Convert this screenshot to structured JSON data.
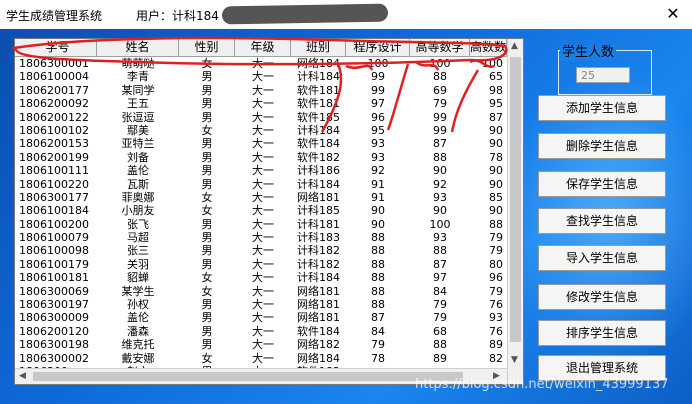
{
  "window": {
    "title": "学生成绩管理系统",
    "user_label": "用户：计科184",
    "close": "✕"
  },
  "table": {
    "columns": [
      "学号",
      "姓名",
      "性别",
      "年级",
      "班别",
      "程序设计",
      "高等数学",
      "高数数"
    ],
    "rows": [
      [
        "1806300001",
        "萌萌哒",
        "女",
        "大一",
        "网络184",
        "100",
        "100",
        "100"
      ],
      [
        "1806100004",
        "李青",
        "男",
        "大一",
        "计科184",
        "99",
        "88",
        "65"
      ],
      [
        "1806200177",
        "某同学",
        "男",
        "大一",
        "软件181",
        "99",
        "69",
        "98"
      ],
      [
        "1806200092",
        "王五",
        "男",
        "大一",
        "软件181",
        "97",
        "79",
        "95"
      ],
      [
        "1806200122",
        "张逗逗",
        "男",
        "大一",
        "软件185",
        "96",
        "99",
        "87"
      ],
      [
        "1806100102",
        "鄢美",
        "女",
        "大一",
        "计科184",
        "95",
        "99",
        "90"
      ],
      [
        "1806200153",
        "亚特兰",
        "男",
        "大一",
        "软件184",
        "93",
        "87",
        "90"
      ],
      [
        "1806200199",
        "刘备",
        "男",
        "大一",
        "软件182",
        "93",
        "88",
        "78"
      ],
      [
        "1806100111",
        "盖伦",
        "男",
        "大一",
        "计科186",
        "92",
        "90",
        "90"
      ],
      [
        "1806100220",
        "瓦斯",
        "男",
        "大一",
        "计科184",
        "91",
        "92",
        "90"
      ],
      [
        "1806300177",
        "菲奥娜",
        "女",
        "大一",
        "网络181",
        "91",
        "93",
        "85"
      ],
      [
        "1806100184",
        "小朋友",
        "女",
        "大一",
        "计科185",
        "90",
        "90",
        "90"
      ],
      [
        "1806100200",
        "张飞",
        "男",
        "大一",
        "计科181",
        "90",
        "100",
        "88"
      ],
      [
        "1806100079",
        "马超",
        "男",
        "大一",
        "计科183",
        "88",
        "93",
        "79"
      ],
      [
        "1806100098",
        "张三",
        "男",
        "大一",
        "计科182",
        "88",
        "88",
        "79"
      ],
      [
        "1806100179",
        "关羽",
        "男",
        "大一",
        "计科182",
        "88",
        "87",
        "80"
      ],
      [
        "1806100181",
        "貂蝉",
        "女",
        "大一",
        "计科184",
        "88",
        "97",
        "96"
      ],
      [
        "1806300069",
        "某学生",
        "女",
        "大一",
        "网络181",
        "88",
        "84",
        "79"
      ],
      [
        "1806300197",
        "孙权",
        "男",
        "大一",
        "网络181",
        "88",
        "79",
        "76"
      ],
      [
        "1806300009",
        "盖伦",
        "男",
        "大一",
        "网络181",
        "87",
        "79",
        "93"
      ],
      [
        "1806200120",
        "潘森",
        "男",
        "大一",
        "软件184",
        "84",
        "68",
        "76"
      ],
      [
        "1806300198",
        "维克托",
        "男",
        "大一",
        "网络182",
        "79",
        "88",
        "89"
      ],
      [
        "1806300002",
        "戴安娜",
        "女",
        "大一",
        "网络184",
        "78",
        "89",
        "82"
      ],
      [
        "1806300...",
        "赵六",
        "男",
        "大一",
        "软件182",
        "..",
        "..",
        ".."
      ]
    ]
  },
  "sidebar": {
    "count_label": "学生人数",
    "count_value": "25",
    "buttons": [
      "添加学生信息",
      "删除学生信息",
      "保存学生信息",
      "查找学生信息",
      "导入学生信息",
      "修改学生信息",
      "排序学生信息",
      "退出管理系统"
    ]
  },
  "watermark": "https://blog.csdn.net/weixin_43999137"
}
